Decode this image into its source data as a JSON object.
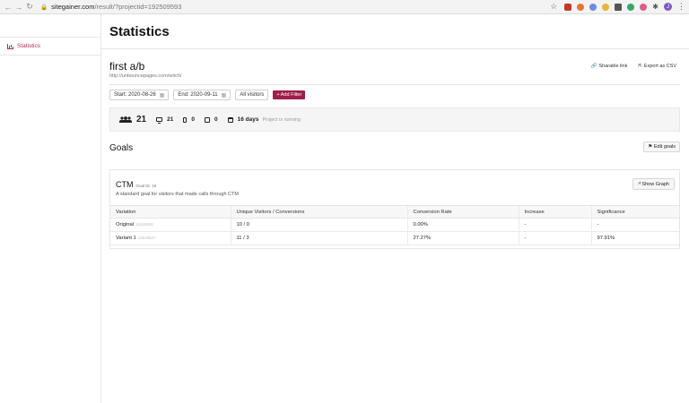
{
  "browser": {
    "url_host": "sitegainer.com",
    "url_path": "/result/?projectid=192509593",
    "profile_initial": "J"
  },
  "sidebar": {
    "items": [
      {
        "label": "Statistics",
        "active": true,
        "icon": "bar-chart-icon"
      }
    ]
  },
  "header": {
    "title": "Statistics"
  },
  "project": {
    "name": "first a/b",
    "url": "http://unbouncepages.com/witch/",
    "shareable_label": "Sharable link",
    "export_label": "Export as CSV"
  },
  "filters": {
    "start": "Start: 2020-08-26",
    "end": "End: 2020-09-11",
    "visitors": "All visitors",
    "add_filter": "+ Add Filter"
  },
  "stats": {
    "total_visitors": "21",
    "desktop": "21",
    "mobile": "0",
    "tablet": "0",
    "days": "16 days",
    "status": "Project is running"
  },
  "goals": {
    "heading": "Goals",
    "edit_label": "Edit goals",
    "items": [
      {
        "name": "CTM",
        "goal_id": "Goal ID: 18",
        "description": "A standard goal for visitors that made calls through CTM",
        "show_graph_label": "Show Graph",
        "columns": [
          "Variation",
          "Unique Visitors / Conversions",
          "Conversion Rate",
          "Increase",
          "Significance"
        ],
        "rows": [
          {
            "variation": "Original",
            "variation_id": "11610600",
            "visitors_conversions": "10 / 0",
            "conversion_rate": "0.00%",
            "increase": "-",
            "significance": "-"
          },
          {
            "variation": "Variant 1",
            "variation_id": "11610627",
            "visitors_conversions": "11 / 3",
            "conversion_rate": "27.27%",
            "increase": "-",
            "significance": "97.91%"
          }
        ]
      }
    ]
  },
  "colors": {
    "accent": "#9e1f4a",
    "sidebar_active": "#a8324a"
  }
}
